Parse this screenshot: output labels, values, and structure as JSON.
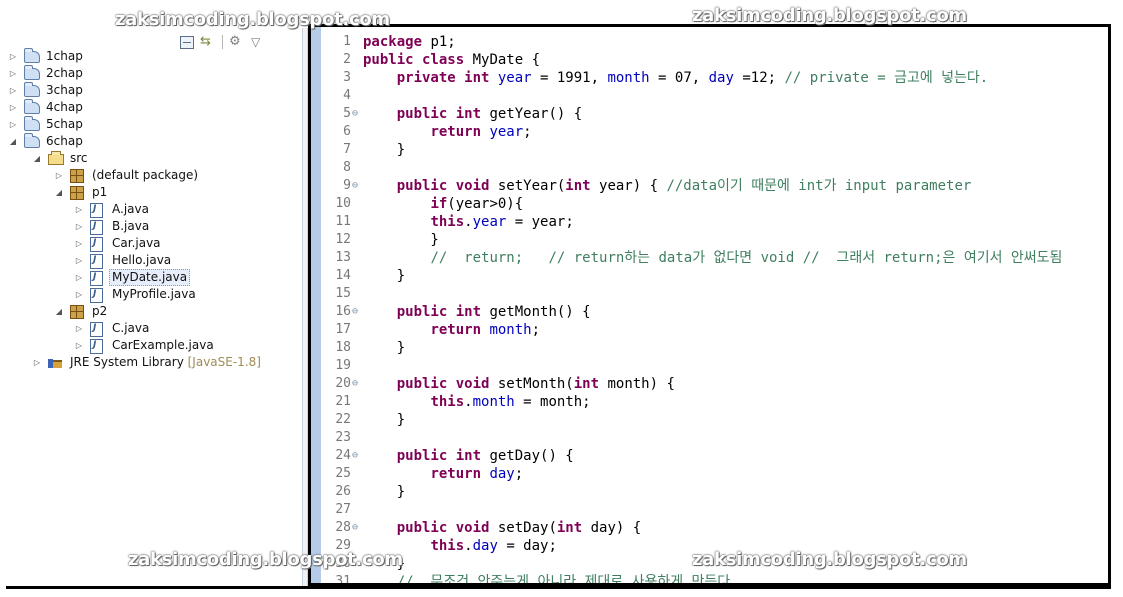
{
  "watermarks": [
    "zaksimcoding.blogspot.com",
    "zaksimcoding.blogspot.com",
    "zaksimcoding.blogspot.com",
    "zaksimcoding.blogspot.com"
  ],
  "explorer": {
    "toolbar": [
      "collapse-all-icon",
      "link-with-editor-icon",
      "view-menu-icon",
      "chevron-down-icon"
    ],
    "tree": [
      {
        "label": "1chap",
        "icon": "project",
        "arrow": "▷",
        "expanded": false
      },
      {
        "label": "2chap",
        "icon": "project",
        "arrow": "▷",
        "expanded": false
      },
      {
        "label": "3chap",
        "icon": "project",
        "arrow": "▷",
        "expanded": false
      },
      {
        "label": "4chap",
        "icon": "project",
        "arrow": "▷",
        "expanded": false
      },
      {
        "label": "5chap",
        "icon": "project",
        "arrow": "▷",
        "expanded": false
      },
      {
        "label": "6chap",
        "icon": "project",
        "arrow": "◢",
        "expanded": true
      },
      {
        "label": "src",
        "icon": "src",
        "arrow": "◢",
        "expanded": true
      },
      {
        "label": "(default package)",
        "icon": "pkg",
        "arrow": "▷",
        "expanded": false
      },
      {
        "label": "p1",
        "icon": "pkg",
        "arrow": "◢",
        "expanded": true
      },
      {
        "label": "A.java",
        "icon": "java",
        "arrow": "▷",
        "expanded": false
      },
      {
        "label": "B.java",
        "icon": "java",
        "arrow": "▷",
        "expanded": false
      },
      {
        "label": "Car.java",
        "icon": "java",
        "arrow": "▷",
        "expanded": false
      },
      {
        "label": "Hello.java",
        "icon": "java",
        "arrow": "▷",
        "expanded": false
      },
      {
        "label": "MyDate.java",
        "icon": "java",
        "arrow": "▷",
        "expanded": false,
        "selected": true
      },
      {
        "label": "MyProfile.java",
        "icon": "java",
        "arrow": "▷",
        "expanded": false
      },
      {
        "label": "p2",
        "icon": "pkg",
        "arrow": "◢",
        "expanded": true
      },
      {
        "label": "C.java",
        "icon": "java",
        "arrow": "▷",
        "expanded": false
      },
      {
        "label": "CarExample.java",
        "icon": "java",
        "arrow": "▷",
        "expanded": false
      },
      {
        "label": "JRE System Library",
        "suffix": "[JavaSE-1.8]",
        "icon": "jre",
        "arrow": "▷",
        "expanded": false
      }
    ]
  },
  "editor": {
    "lines": [
      {
        "n": "1",
        "fold": "",
        "tokens": [
          [
            "kw",
            "package"
          ],
          [
            "plain",
            " p1;"
          ]
        ]
      },
      {
        "n": "2",
        "fold": "",
        "tokens": [
          [
            "kw",
            "public class"
          ],
          [
            "plain",
            " MyDate {"
          ]
        ]
      },
      {
        "n": "3",
        "fold": "",
        "tokens": [
          [
            "plain",
            "    "
          ],
          [
            "kw",
            "private int"
          ],
          [
            "plain",
            " "
          ],
          [
            "field",
            "year"
          ],
          [
            "plain",
            " = 1991, "
          ],
          [
            "field",
            "month"
          ],
          [
            "plain",
            " = 07, "
          ],
          [
            "field",
            "day"
          ],
          [
            "plain",
            " =12; "
          ],
          [
            "cm",
            "// private = 금고에 넣는다."
          ]
        ]
      },
      {
        "n": "4",
        "fold": "",
        "tokens": []
      },
      {
        "n": "5",
        "fold": "⊖",
        "tokens": [
          [
            "plain",
            "    "
          ],
          [
            "kw",
            "public int"
          ],
          [
            "plain",
            " getYear() {"
          ]
        ]
      },
      {
        "n": "6",
        "fold": "",
        "tokens": [
          [
            "plain",
            "        "
          ],
          [
            "kw",
            "return"
          ],
          [
            "plain",
            " "
          ],
          [
            "field",
            "year"
          ],
          [
            "plain",
            ";"
          ]
        ]
      },
      {
        "n": "7",
        "fold": "",
        "tokens": [
          [
            "plain",
            "    }"
          ]
        ]
      },
      {
        "n": "8",
        "fold": "",
        "tokens": []
      },
      {
        "n": "9",
        "fold": "⊖",
        "tokens": [
          [
            "plain",
            "    "
          ],
          [
            "kw",
            "public void"
          ],
          [
            "plain",
            " setYear("
          ],
          [
            "kw",
            "int"
          ],
          [
            "plain",
            " year) { "
          ],
          [
            "cm",
            "//data이기 때문에 int가 input parameter"
          ]
        ]
      },
      {
        "n": "10",
        "fold": "",
        "tokens": [
          [
            "plain",
            "        "
          ],
          [
            "kw",
            "if"
          ],
          [
            "plain",
            "(year>0){"
          ]
        ]
      },
      {
        "n": "11",
        "fold": "",
        "tokens": [
          [
            "plain",
            "        "
          ],
          [
            "kw",
            "this"
          ],
          [
            "plain",
            "."
          ],
          [
            "field",
            "year"
          ],
          [
            "plain",
            " = year;"
          ]
        ]
      },
      {
        "n": "12",
        "fold": "",
        "tokens": [
          [
            "plain",
            "        }"
          ]
        ]
      },
      {
        "n": "13",
        "fold": "",
        "tokens": [
          [
            "plain",
            "        "
          ],
          [
            "cm",
            "//  return;   // return하는 data가 없다면 void //  그래서 return;은 여기서 안써도됨"
          ]
        ]
      },
      {
        "n": "14",
        "fold": "",
        "tokens": [
          [
            "plain",
            "    }"
          ]
        ]
      },
      {
        "n": "15",
        "fold": "",
        "tokens": []
      },
      {
        "n": "16",
        "fold": "⊖",
        "tokens": [
          [
            "plain",
            "    "
          ],
          [
            "kw",
            "public int"
          ],
          [
            "plain",
            " getMonth() {"
          ]
        ]
      },
      {
        "n": "17",
        "fold": "",
        "tokens": [
          [
            "plain",
            "        "
          ],
          [
            "kw",
            "return"
          ],
          [
            "plain",
            " "
          ],
          [
            "field",
            "month"
          ],
          [
            "plain",
            ";"
          ]
        ]
      },
      {
        "n": "18",
        "fold": "",
        "tokens": [
          [
            "plain",
            "    }"
          ]
        ]
      },
      {
        "n": "19",
        "fold": "",
        "tokens": []
      },
      {
        "n": "20",
        "fold": "⊖",
        "tokens": [
          [
            "plain",
            "    "
          ],
          [
            "kw",
            "public void"
          ],
          [
            "plain",
            " setMonth("
          ],
          [
            "kw",
            "int"
          ],
          [
            "plain",
            " month) {"
          ]
        ]
      },
      {
        "n": "21",
        "fold": "",
        "tokens": [
          [
            "plain",
            "        "
          ],
          [
            "kw",
            "this"
          ],
          [
            "plain",
            "."
          ],
          [
            "field",
            "month"
          ],
          [
            "plain",
            " = month;"
          ]
        ]
      },
      {
        "n": "22",
        "fold": "",
        "tokens": [
          [
            "plain",
            "    }"
          ]
        ]
      },
      {
        "n": "23",
        "fold": "",
        "tokens": []
      },
      {
        "n": "24",
        "fold": "⊖",
        "tokens": [
          [
            "plain",
            "    "
          ],
          [
            "kw",
            "public int"
          ],
          [
            "plain",
            " getDay() {"
          ]
        ]
      },
      {
        "n": "25",
        "fold": "",
        "tokens": [
          [
            "plain",
            "        "
          ],
          [
            "kw",
            "return"
          ],
          [
            "plain",
            " "
          ],
          [
            "field",
            "day"
          ],
          [
            "plain",
            ";"
          ]
        ]
      },
      {
        "n": "26",
        "fold": "",
        "tokens": [
          [
            "plain",
            "    }"
          ]
        ]
      },
      {
        "n": "27",
        "fold": "",
        "tokens": []
      },
      {
        "n": "28",
        "fold": "⊖",
        "tokens": [
          [
            "plain",
            "    "
          ],
          [
            "kw",
            "public void"
          ],
          [
            "plain",
            " setDay("
          ],
          [
            "kw",
            "int"
          ],
          [
            "plain",
            " day) {"
          ]
        ]
      },
      {
        "n": "29",
        "fold": "",
        "tokens": [
          [
            "plain",
            "        "
          ],
          [
            "kw",
            "this"
          ],
          [
            "plain",
            "."
          ],
          [
            "field",
            "day"
          ],
          [
            "plain",
            " = day;"
          ]
        ]
      },
      {
        "n": "30",
        "fold": "",
        "tokens": [
          [
            "plain",
            "    }"
          ]
        ]
      },
      {
        "n": "31",
        "fold": "",
        "tokens": [
          [
            "plain",
            "    "
          ],
          [
            "cm",
            "//  무조건 안주는게 아니라 제대로 사용하게 만든다."
          ]
        ]
      }
    ]
  }
}
